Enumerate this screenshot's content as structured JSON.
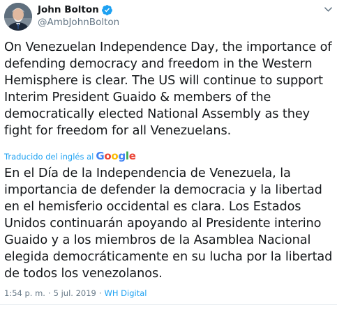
{
  "user": {
    "display_name": "John Bolton",
    "handle": "@AmbJohnBolton",
    "verified": true,
    "avatar": "profile-photo"
  },
  "tweet": {
    "text": "On Venezuelan Independence Day, the importance of defending democracy and freedom in the Western Hemisphere is clear. The US will continue to support Interim President Guaido & members of the democratically elected National Assembly as they fight for freedom for all Venezuelans."
  },
  "translation": {
    "label": "Traducido del inglés al",
    "provider": "Google",
    "text": "En el Día de la Independencia de Venezuela, la importancia de defender la democracia y la libertad en el hemisferio occidental es clara. Los Estados Unidos continuarán apoyando al Presidente interino Guaido y a los miembros de la Asamblea Nacional elegida democráticamente en su lucha por la libertad de todos los venezolanos."
  },
  "meta": {
    "time": "1:54 p. m.",
    "separator": "·",
    "date": "5 jul. 2019",
    "source": "WH Digital"
  },
  "icons": {
    "verified": "verified-badge-icon",
    "more": "chevron-down-icon"
  },
  "colors": {
    "link": "#1da1f2",
    "muted": "#657786",
    "text": "#14171a",
    "verified": "#1da1f2"
  }
}
